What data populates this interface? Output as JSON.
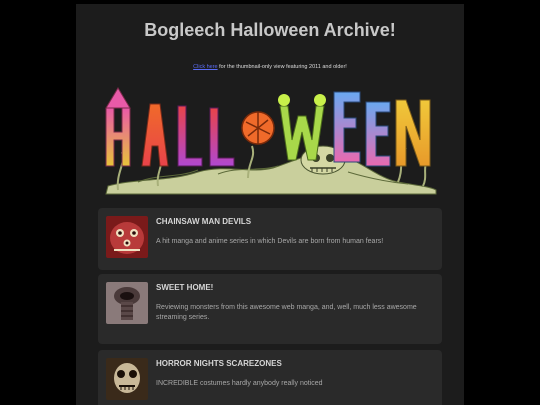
{
  "title": "Bogleech Halloween Archive!",
  "subline": {
    "link": "Click here",
    "rest": " for the thumbnail-only view featuring 2011 and older!"
  },
  "banner_text": "HALLOWEEN",
  "cards": [
    {
      "title": "CHAINSAW MAN DEVILS",
      "desc": "A hit manga and anime series in which Devils are born from human fears!"
    },
    {
      "title": "SWEET HOME!",
      "desc": "Reviewing monsters from this awesome web manga, and, well, much less awesome streaming series."
    },
    {
      "title": "HORROR NIGHTS SCAREZONES",
      "desc": "INCREDIBLE costumes hardly anybody really noticed"
    }
  ],
  "colors": {
    "page_bg": "#1c1c1c",
    "card_bg": "#2a2a2a",
    "link": "#5b6cf5"
  }
}
